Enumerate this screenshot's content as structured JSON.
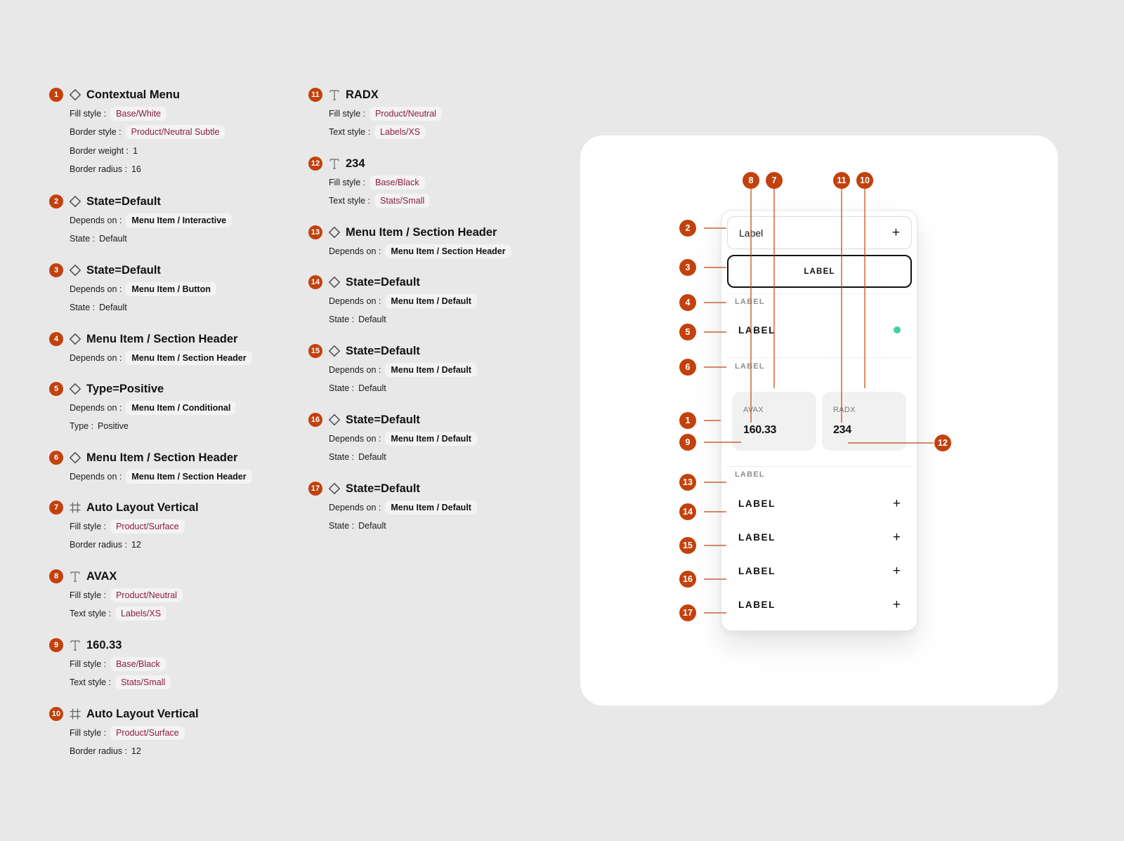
{
  "accent": "#c2410c",
  "chip_text_color": "#8a1c3c",
  "specs": [
    {
      "num": "1",
      "icon": "component-icon",
      "title": "Contextual Menu",
      "props": [
        {
          "label": "Fill style :",
          "chip": "Base/White"
        },
        {
          "label": "Border style :",
          "chip": "Product/Neutral Subtle"
        },
        {
          "label": "Border weight :",
          "value": "1"
        },
        {
          "label": "Border radius :",
          "value": "16"
        }
      ]
    },
    {
      "num": "2",
      "icon": "component-icon",
      "title": "State=Default",
      "props": [
        {
          "label": "Depends on :",
          "chip": "Menu Item / Interactive"
        },
        {
          "label": "State :",
          "value": "Default"
        }
      ]
    },
    {
      "num": "3",
      "icon": "component-icon",
      "title": "State=Default",
      "props": [
        {
          "label": "Depends on :",
          "chip": "Menu Item / Button"
        },
        {
          "label": "State :",
          "value": "Default"
        }
      ]
    },
    {
      "num": "4",
      "icon": "component-icon",
      "title": "Menu Item / Section Header",
      "props": [
        {
          "label": "Depends on :",
          "chip": "Menu Item / Section Header"
        }
      ]
    },
    {
      "num": "5",
      "icon": "component-icon",
      "title": "Type=Positive",
      "props": [
        {
          "label": "Depends on :",
          "chip": "Menu Item / Conditional"
        },
        {
          "label": "Type :",
          "value": "Positive"
        }
      ]
    },
    {
      "num": "6",
      "icon": "component-icon",
      "title": "Menu Item / Section Header",
      "props": [
        {
          "label": "Depends on :",
          "chip": "Menu Item / Section Header"
        }
      ]
    },
    {
      "num": "7",
      "icon": "frame-icon",
      "title": "Auto Layout Vertical",
      "props": [
        {
          "label": "Fill style :",
          "chip": "Product/Surface"
        },
        {
          "label": "Border radius :",
          "value": "12"
        }
      ]
    },
    {
      "num": "8",
      "icon": "text-icon",
      "title": "AVAX",
      "props": [
        {
          "label": "Fill style :",
          "chip": "Product/Neutral"
        },
        {
          "label": "Text style :",
          "chip": "Labels/XS"
        }
      ]
    },
    {
      "num": "9",
      "icon": "text-icon",
      "title": "160.33",
      "props": [
        {
          "label": "Fill style :",
          "chip": "Base/Black"
        },
        {
          "label": "Text style :",
          "chip": "Stats/Small"
        }
      ]
    },
    {
      "num": "10",
      "icon": "frame-icon",
      "title": "Auto Layout Vertical",
      "props": [
        {
          "label": "Fill style :",
          "chip": "Product/Surface"
        },
        {
          "label": "Border radius :",
          "value": "12"
        }
      ]
    },
    {
      "num": "11",
      "icon": "text-icon",
      "title": "RADX",
      "props": [
        {
          "label": "Fill style :",
          "chip": "Product/Neutral"
        },
        {
          "label": "Text style :",
          "chip": "Labels/XS"
        }
      ]
    },
    {
      "num": "12",
      "icon": "text-icon",
      "title": "234",
      "props": [
        {
          "label": "Fill style :",
          "chip": "Base/Black"
        },
        {
          "label": "Text style :",
          "chip": "Stats/Small"
        }
      ]
    },
    {
      "num": "13",
      "icon": "component-icon",
      "title": "Menu Item / Section Header",
      "props": [
        {
          "label": "Depends on :",
          "chip": "Menu Item / Section Header"
        }
      ]
    },
    {
      "num": "14",
      "icon": "component-icon",
      "title": "State=Default",
      "props": [
        {
          "label": "Depends on :",
          "chip": "Menu Item / Default"
        },
        {
          "label": "State :",
          "value": "Default"
        }
      ]
    },
    {
      "num": "15",
      "icon": "component-icon",
      "title": "State=Default",
      "props": [
        {
          "label": "Depends on :",
          "chip": "Menu Item / Default"
        },
        {
          "label": "State :",
          "value": "Default"
        }
      ]
    },
    {
      "num": "16",
      "icon": "component-icon",
      "title": "State=Default",
      "props": [
        {
          "label": "Depends on :",
          "chip": "Menu Item / Default"
        },
        {
          "label": "State :",
          "value": "Default"
        }
      ]
    },
    {
      "num": "17",
      "icon": "component-icon",
      "title": "State=Default",
      "props": [
        {
          "label": "Depends on :",
          "chip": "Menu Item / Default"
        },
        {
          "label": "State :",
          "value": "Default"
        }
      ]
    }
  ],
  "menu": {
    "input_label": "Label",
    "input_icon": "plus-icon",
    "button_label": "LABEL",
    "section_header_1": "LABEL",
    "positive_item_label": "LABEL",
    "positive_dot_color": "#3ed39a",
    "section_header_2": "LABEL",
    "stats": [
      {
        "label": "AVAX",
        "value": "160.33"
      },
      {
        "label": "RADX",
        "value": "234"
      }
    ],
    "section_header_3": "LABEL",
    "items": [
      "LABEL",
      "LABEL",
      "LABEL",
      "LABEL"
    ],
    "item_icon": "plus-icon"
  },
  "annotations": [
    "1",
    "2",
    "3",
    "4",
    "5",
    "6",
    "7",
    "8",
    "9",
    "10",
    "11",
    "12",
    "13",
    "14",
    "15",
    "16",
    "17"
  ]
}
